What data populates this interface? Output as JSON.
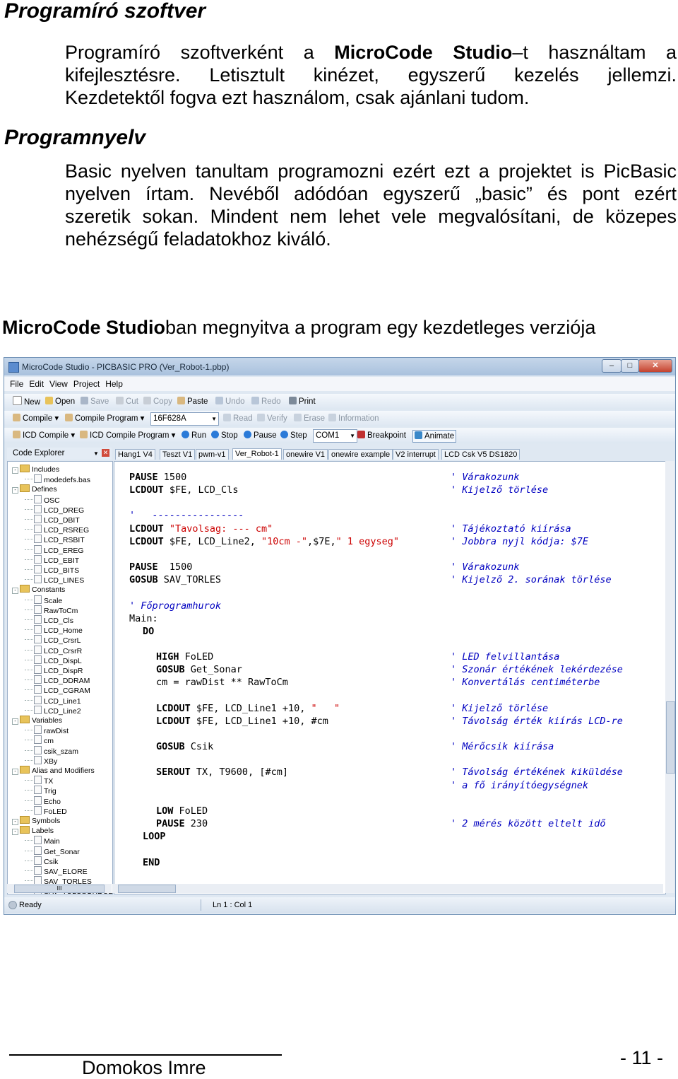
{
  "headings": {
    "software": "Programíró szoftver",
    "language": "Programnyelv"
  },
  "p1": {
    "l1_a": "Programíró szoftverként a ",
    "l1_bold": "MicroCode Studio",
    "l1_b": "–t használtam a",
    "l2": "kifejlesztésre. Letisztult kinézet, egyszerű kezelés jellemzi.",
    "l3": "Kezdetektől fogva ezt használom, csak ajánlani tudom."
  },
  "p2": {
    "l1": "Basic nyelven tanultam programozni ezért ezt a projektet is PicBasic",
    "l2": "nyelven írtam. Nevéből adódóan egyszerű „basic” és pont ezért",
    "l3": "szeretik sokan. Mindent nem lehet vele megvalósítani, de közepes",
    "l4": "nehézségű feladatokhoz kiváló."
  },
  "caption": {
    "bold": "MicroCode Studio",
    "rest": "ban megnyitva a program egy kezdetleges verziója"
  },
  "window": {
    "title": "MicroCode Studio - PICBASIC PRO (Ver_Robot-1.pbp)",
    "menu": [
      "File",
      "Edit",
      "View",
      "Project",
      "Help"
    ],
    "toolbar1": [
      "New",
      "Open",
      "Save",
      "Cut",
      "Copy",
      "Paste",
      "Undo",
      "Redo",
      "Print"
    ],
    "toolbar2": {
      "compile": "Compile",
      "compile_program": "Compile Program",
      "device": "16F628A",
      "read": "Read",
      "verify": "Verify",
      "erase": "Erase",
      "information": "Information"
    },
    "toolbar3": {
      "icd_compile": "ICD Compile",
      "icd_compile_program": "ICD Compile Program",
      "run": "Run",
      "stop": "Stop",
      "pause": "Pause",
      "step": "Step",
      "port": "COM1",
      "breakpoint": "Breakpoint",
      "animate": "Animate"
    },
    "explorer_title": "Code Explorer",
    "tabs": [
      "Hang1 V4",
      "Teszt V1",
      "pwm-v1",
      "Ver_Robot-1",
      "onewire V1",
      "onewire example",
      "V2 interrupt",
      "LCD Csk V5 DS1820"
    ],
    "tree": [
      {
        "label": "Includes",
        "type": "folder",
        "level": 0
      },
      {
        "label": "modedefs.bas",
        "type": "file",
        "level": 1
      },
      {
        "label": "Defines",
        "type": "folder",
        "level": 0
      },
      {
        "label": "OSC",
        "type": "file",
        "level": 1
      },
      {
        "label": "LCD_DREG",
        "type": "file",
        "level": 1
      },
      {
        "label": "LCD_DBIT",
        "type": "file",
        "level": 1
      },
      {
        "label": "LCD_RSREG",
        "type": "file",
        "level": 1
      },
      {
        "label": "LCD_RSBIT",
        "type": "file",
        "level": 1
      },
      {
        "label": "LCD_EREG",
        "type": "file",
        "level": 1
      },
      {
        "label": "LCD_EBIT",
        "type": "file",
        "level": 1
      },
      {
        "label": "LCD_BITS",
        "type": "file",
        "level": 1
      },
      {
        "label": "LCD_LINES",
        "type": "file",
        "level": 1
      },
      {
        "label": "Constants",
        "type": "folder",
        "level": 0
      },
      {
        "label": "Scale",
        "type": "file",
        "level": 1
      },
      {
        "label": "RawToCm",
        "type": "file",
        "level": 1
      },
      {
        "label": "LCD_Cls",
        "type": "file",
        "level": 1
      },
      {
        "label": "LCD_Home",
        "type": "file",
        "level": 1
      },
      {
        "label": "LCD_CrsrL",
        "type": "file",
        "level": 1
      },
      {
        "label": "LCD_CrsrR",
        "type": "file",
        "level": 1
      },
      {
        "label": "LCD_DispL",
        "type": "file",
        "level": 1
      },
      {
        "label": "LCD_DispR",
        "type": "file",
        "level": 1
      },
      {
        "label": "LCD_DDRAM",
        "type": "file",
        "level": 1
      },
      {
        "label": "LCD_CGRAM",
        "type": "file",
        "level": 1
      },
      {
        "label": "LCD_Line1",
        "type": "file",
        "level": 1
      },
      {
        "label": "LCD_Line2",
        "type": "file",
        "level": 1
      },
      {
        "label": "Variables",
        "type": "folder",
        "level": 0
      },
      {
        "label": "rawDist",
        "type": "file",
        "level": 1
      },
      {
        "label": "cm",
        "type": "file",
        "level": 1
      },
      {
        "label": "csik_szam",
        "type": "file",
        "level": 1
      },
      {
        "label": "XBy",
        "type": "file",
        "level": 1
      },
      {
        "label": "Alias and Modifiers",
        "type": "folder",
        "level": 0
      },
      {
        "label": "TX",
        "type": "file",
        "level": 1
      },
      {
        "label": "Trig",
        "type": "file",
        "level": 1
      },
      {
        "label": "Echo",
        "type": "file",
        "level": 1
      },
      {
        "label": "FoLED",
        "type": "file",
        "level": 1
      },
      {
        "label": "Symbols",
        "type": "folder",
        "level": 0
      },
      {
        "label": "Labels",
        "type": "folder",
        "level": 0
      },
      {
        "label": "Main",
        "type": "file",
        "level": 1
      },
      {
        "label": "Get_Sonar",
        "type": "file",
        "level": 1
      },
      {
        "label": "Csik",
        "type": "file",
        "level": 1
      },
      {
        "label": "SAV_ELORE",
        "type": "file",
        "level": 1
      },
      {
        "label": "SAV_TORLES",
        "type": "file",
        "level": 1
      },
      {
        "label": "SAV_TULCSORDUL",
        "type": "file",
        "level": 1
      }
    ],
    "code": [
      {
        "row": 0,
        "indent": 0,
        "parts": [
          {
            "t": "PAUSE",
            "c": "kw"
          },
          {
            "t": " 1500",
            "c": ""
          }
        ],
        "comment": "' Várakozunk"
      },
      {
        "row": 1,
        "indent": 0,
        "parts": [
          {
            "t": "LCDOUT",
            "c": "kw"
          },
          {
            "t": " $FE, LCD_Cls",
            "c": ""
          }
        ],
        "comment": "' Kijelző törlése"
      },
      {
        "row": 3,
        "indent": 0,
        "parts": [
          {
            "t": "'   ----------------",
            "c": "cmt"
          }
        ],
        "comment": ""
      },
      {
        "row": 4,
        "indent": 0,
        "parts": [
          {
            "t": "LCDOUT",
            "c": "kw"
          },
          {
            "t": " ",
            "c": ""
          },
          {
            "t": "\"Tavolsag: --- cm\"",
            "c": "str"
          }
        ],
        "comment": "' Tájékoztató kiírása"
      },
      {
        "row": 5,
        "indent": 0,
        "parts": [
          {
            "t": "LCDOUT",
            "c": "kw"
          },
          {
            "t": " $FE, LCD_Line2, ",
            "c": ""
          },
          {
            "t": "\"10cm -\"",
            "c": "str"
          },
          {
            "t": ",$7E,",
            "c": ""
          },
          {
            "t": "\" 1 egyseg\"",
            "c": "str"
          }
        ],
        "comment": "' Jobbra nyjl kódja: $7E"
      },
      {
        "row": 7,
        "indent": 0,
        "parts": [
          {
            "t": "PAUSE",
            "c": "kw"
          },
          {
            "t": "  1500",
            "c": ""
          }
        ],
        "comment": "' Várakozunk"
      },
      {
        "row": 8,
        "indent": 0,
        "parts": [
          {
            "t": "GOSUB",
            "c": "kw"
          },
          {
            "t": " SAV_TORLES",
            "c": ""
          }
        ],
        "comment": "' Kijelző 2. sorának törlése"
      },
      {
        "row": 10,
        "indent": 0,
        "parts": [
          {
            "t": "' Főprogramhurok",
            "c": "cmt"
          }
        ],
        "comment": ""
      },
      {
        "row": 11,
        "indent": 0,
        "parts": [
          {
            "t": "Main:",
            "c": ""
          }
        ],
        "comment": ""
      },
      {
        "row": 12,
        "indent": 1,
        "parts": [
          {
            "t": "DO",
            "c": "kw"
          }
        ],
        "comment": ""
      },
      {
        "row": 14,
        "indent": 2,
        "parts": [
          {
            "t": "HIGH",
            "c": "kw"
          },
          {
            "t": " FoLED",
            "c": ""
          }
        ],
        "comment": "' LED felvillantása"
      },
      {
        "row": 15,
        "indent": 2,
        "parts": [
          {
            "t": "GOSUB",
            "c": "kw"
          },
          {
            "t": " Get_Sonar",
            "c": ""
          }
        ],
        "comment": "' Szonár értékének lekérdezése"
      },
      {
        "row": 16,
        "indent": 2,
        "parts": [
          {
            "t": "cm = rawDist ** RawToCm",
            "c": ""
          }
        ],
        "comment": "' Konvertálás centiméterbe"
      },
      {
        "row": 18,
        "indent": 2,
        "parts": [
          {
            "t": "LCDOUT",
            "c": "kw"
          },
          {
            "t": " $FE, LCD_Line1 +10, ",
            "c": ""
          },
          {
            "t": "\"   \"",
            "c": "str"
          }
        ],
        "comment": "' Kijelző törlése"
      },
      {
        "row": 19,
        "indent": 2,
        "parts": [
          {
            "t": "LCDOUT",
            "c": "kw"
          },
          {
            "t": " $FE, LCD_Line1 +10, #cm",
            "c": ""
          }
        ],
        "comment": "' Távolság érték kiírás LCD-re"
      },
      {
        "row": 21,
        "indent": 2,
        "parts": [
          {
            "t": "GOSUB",
            "c": "kw"
          },
          {
            "t": " Csik",
            "c": ""
          }
        ],
        "comment": "' Mérőcsik kiírása"
      },
      {
        "row": 23,
        "indent": 2,
        "parts": [
          {
            "t": "SEROUT",
            "c": "kw"
          },
          {
            "t": " TX, T9600, [#cm]",
            "c": ""
          }
        ],
        "comment": "' Távolság értékének kiküldése"
      },
      {
        "row": 24,
        "indent": 2,
        "parts": [],
        "comment": "' a fő irányítóegységnek"
      },
      {
        "row": 26,
        "indent": 2,
        "parts": [
          {
            "t": "LOW",
            "c": "kw"
          },
          {
            "t": " FoLED",
            "c": ""
          }
        ],
        "comment": ""
      },
      {
        "row": 27,
        "indent": 2,
        "parts": [
          {
            "t": "PAUSE",
            "c": "kw"
          },
          {
            "t": " 230",
            "c": ""
          }
        ],
        "comment": "' 2 mérés között eltelt idő"
      },
      {
        "row": 28,
        "indent": 1,
        "parts": [
          {
            "t": "LOOP",
            "c": "kw"
          }
        ],
        "comment": ""
      },
      {
        "row": 30,
        "indent": 1,
        "parts": [
          {
            "t": "END",
            "c": "kw"
          }
        ],
        "comment": ""
      }
    ],
    "status": {
      "ready": "Ready",
      "position": "Ln 1 : Col 1"
    },
    "scroll_glyph": "III"
  },
  "footer": {
    "author": "Domokos Imre",
    "page": "- 11 -"
  }
}
